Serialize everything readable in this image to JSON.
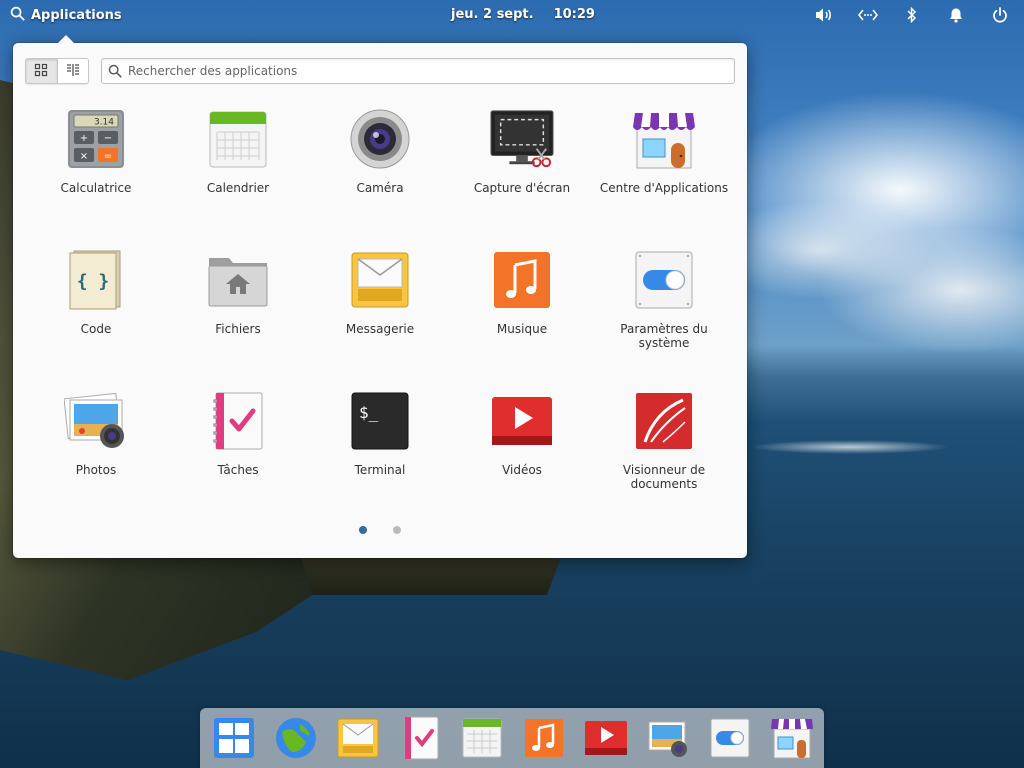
{
  "panel": {
    "applications_label": "Applications",
    "date": "jeu. 2 sept.",
    "time": "10:29",
    "indicators": [
      "volume-icon",
      "network-icon",
      "bluetooth-icon",
      "notifications-icon",
      "power-icon"
    ]
  },
  "launcher": {
    "search_placeholder": "Rechercher des applications",
    "view_modes": [
      "grid-view-icon",
      "category-view-icon"
    ],
    "active_view": "grid",
    "apps": [
      {
        "label": "Calculatrice",
        "icon": "calculator-icon"
      },
      {
        "label": "Calendrier",
        "icon": "calendar-icon"
      },
      {
        "label": "Caméra",
        "icon": "camera-icon"
      },
      {
        "label": "Capture d'écran",
        "icon": "screenshot-icon"
      },
      {
        "label": "Centre d'Applications",
        "icon": "appcenter-icon"
      },
      {
        "label": "Code",
        "icon": "code-icon"
      },
      {
        "label": "Fichiers",
        "icon": "files-icon"
      },
      {
        "label": "Messagerie",
        "icon": "mail-icon"
      },
      {
        "label": "Musique",
        "icon": "music-icon"
      },
      {
        "label": "Paramètres du système",
        "icon": "settings-icon"
      },
      {
        "label": "Photos",
        "icon": "photos-icon"
      },
      {
        "label": "Tâches",
        "icon": "tasks-icon"
      },
      {
        "label": "Terminal",
        "icon": "terminal-icon"
      },
      {
        "label": "Vidéos",
        "icon": "videos-icon"
      },
      {
        "label": "Visionneur de documents",
        "icon": "document-viewer-icon"
      }
    ],
    "pages": 2,
    "current_page": 1
  },
  "dock": {
    "items": [
      "multitasking-icon",
      "web-browser-icon",
      "mail-icon",
      "tasks-icon",
      "calendar-icon",
      "music-icon",
      "videos-icon",
      "photos-icon",
      "settings-icon",
      "appcenter-icon"
    ]
  },
  "colors": {
    "accent": "#3a6a9a",
    "popover_bg": "#fafafa",
    "panel_text": "#ffffff"
  }
}
